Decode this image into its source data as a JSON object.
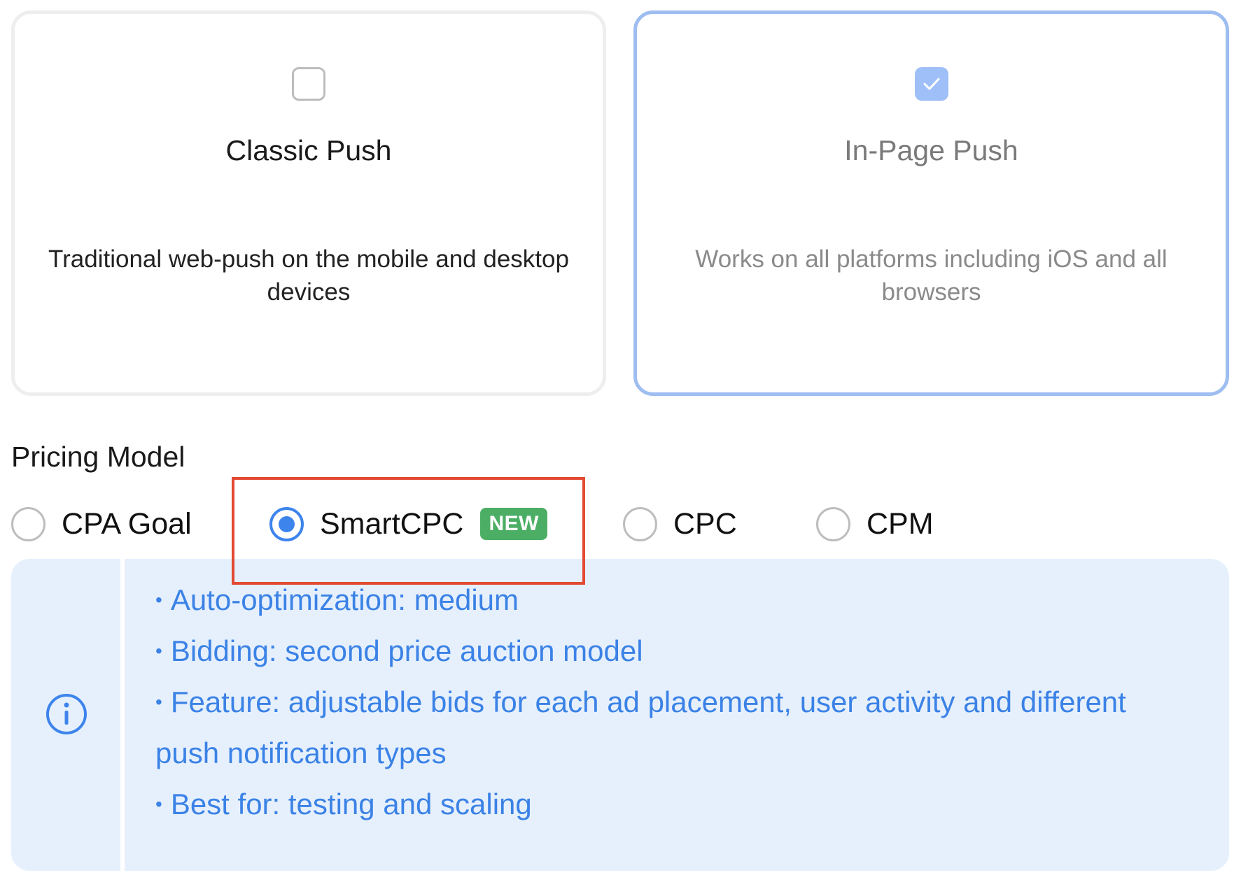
{
  "push_types": [
    {
      "title": "Classic Push",
      "description": "Traditional web-push on the mobile and desktop devices",
      "checked": false
    },
    {
      "title": "In-Page Push",
      "description": "Works on all platforms including iOS and all browsers",
      "checked": true
    }
  ],
  "pricing": {
    "title": "Pricing Model",
    "options": [
      {
        "label": "CPA Goal",
        "selected": false
      },
      {
        "label": "SmartCPC",
        "selected": true,
        "badge": "NEW"
      },
      {
        "label": "CPC",
        "selected": false
      },
      {
        "label": "CPM",
        "selected": false
      }
    ]
  },
  "info": {
    "icon": "info-circle-icon",
    "bullet": "•",
    "items": [
      "Auto-optimization: medium",
      "Bidding: second price auction model",
      "Feature: adjustable bids for each ad placement, user activity and different push notification types",
      "Best for: testing and scaling"
    ]
  },
  "colors": {
    "accent_blue": "#3d84ec",
    "selected_card_border": "#9ebdf0",
    "badge_green": "#4cae65",
    "info_background": "#e6f0fd",
    "info_text": "#3b82e6",
    "highlight_red": "#e24a33"
  }
}
